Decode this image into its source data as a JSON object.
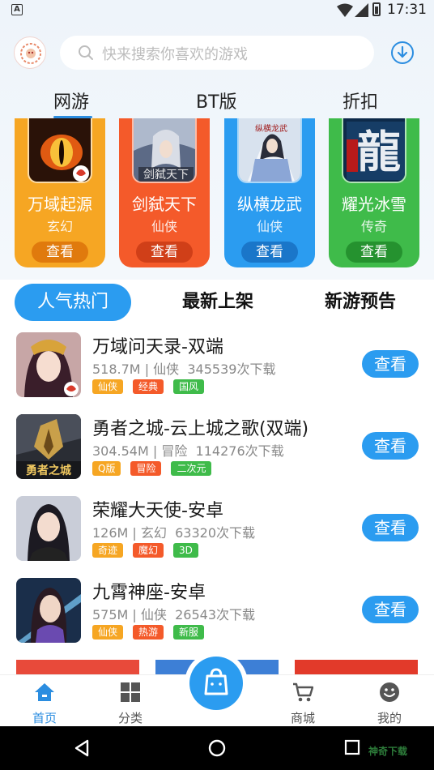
{
  "status_bar": {
    "time": "17:31",
    "app_icon_letter": "A"
  },
  "header": {
    "search_placeholder": "快来搜索你喜欢的游戏"
  },
  "category_tabs": [
    {
      "label": "网游",
      "active": true
    },
    {
      "label": "BT版",
      "active": false
    },
    {
      "label": "折扣",
      "active": false
    }
  ],
  "featured_cards": [
    {
      "name": "万域起源",
      "genre": "玄幻",
      "button": "查看",
      "color": "#f6a623",
      "button_color": "#e07a0d"
    },
    {
      "name": "剑弑天下",
      "genre": "仙侠",
      "button": "查看",
      "color": "#f45a2a",
      "button_color": "#d03f18"
    },
    {
      "name": "纵横龙武",
      "genre": "仙侠",
      "button": "查看",
      "color": "#2b9cf0",
      "button_color": "#1a76c9"
    },
    {
      "name": "耀光冰雪",
      "genre": "传奇",
      "button": "查看",
      "color": "#3fbb4a",
      "button_color": "#25922f"
    }
  ],
  "list_tabs": [
    {
      "label": "人气热门",
      "active": true
    },
    {
      "label": "最新上架",
      "active": false
    },
    {
      "label": "新游预告",
      "active": false
    }
  ],
  "games": [
    {
      "title": "万域问天录-双端",
      "size": "518.7M",
      "genre": "仙侠",
      "downloads": "345539次下载",
      "tags": [
        {
          "text": "仙侠",
          "color": "#f6a623"
        },
        {
          "text": "经典",
          "color": "#f45a2a"
        },
        {
          "text": "国风",
          "color": "#3fbb4a"
        }
      ],
      "button": "查看"
    },
    {
      "title": "勇者之城-云上城之歌(双端)",
      "size": "304.54M",
      "genre": "冒险",
      "downloads": "114276次下载",
      "tags": [
        {
          "text": "Q版",
          "color": "#f6a623"
        },
        {
          "text": "冒险",
          "color": "#f45a2a"
        },
        {
          "text": "二次元",
          "color": "#3fbb4a"
        }
      ],
      "button": "查看"
    },
    {
      "title": "荣耀大天使-安卓",
      "size": "126M",
      "genre": "玄幻",
      "downloads": "63320次下载",
      "tags": [
        {
          "text": "奇迹",
          "color": "#f6a623"
        },
        {
          "text": "魔幻",
          "color": "#f45a2a"
        },
        {
          "text": "3D",
          "color": "#3fbb4a"
        }
      ],
      "button": "查看"
    },
    {
      "title": "九霄神座-安卓",
      "size": "575M",
      "genre": "仙侠",
      "downloads": "26543次下载",
      "tags": [
        {
          "text": "仙侠",
          "color": "#f6a623"
        },
        {
          "text": "热游",
          "color": "#f45a2a"
        },
        {
          "text": "新服",
          "color": "#3fbb4a"
        }
      ],
      "button": "查看"
    }
  ],
  "bottom_nav": [
    {
      "label": "首页",
      "icon": "home-icon",
      "active": true
    },
    {
      "label": "分类",
      "icon": "grid-icon",
      "active": false
    },
    {
      "label": "商城",
      "icon": "cart-icon",
      "active": false
    },
    {
      "label": "我的",
      "icon": "smiley-icon",
      "active": false
    }
  ],
  "watermark": "神奇下载",
  "colors": {
    "accent": "#2b9cf0",
    "orange": "#f6a623",
    "red": "#f45a2a",
    "green": "#3fbb4a"
  }
}
